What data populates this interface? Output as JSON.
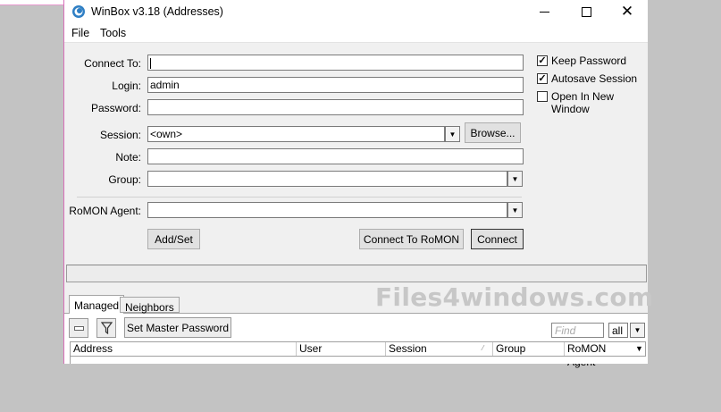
{
  "window": {
    "title": "WinBox v3.18 (Addresses)",
    "minimize_icon": "minimize-icon",
    "maximize_icon": "maximize-icon",
    "close_icon": "close-icon"
  },
  "menu": {
    "file": "File",
    "tools": "Tools"
  },
  "form": {
    "connect_to_label": "Connect To:",
    "connect_to_value": "",
    "login_label": "Login:",
    "login_value": "admin",
    "password_label": "Password:",
    "password_value": "",
    "session_label": "Session:",
    "session_value": "<own>",
    "browse_label": "Browse...",
    "note_label": "Note:",
    "note_value": "",
    "group_label": "Group:",
    "group_value": "",
    "romon_label": "RoMON Agent:",
    "romon_value": ""
  },
  "options": {
    "keep_password": {
      "label": "Keep Password",
      "checked": true
    },
    "autosave_session": {
      "label": "Autosave Session",
      "checked": true
    },
    "open_new_window": {
      "label": "Open In New Window",
      "checked": false
    }
  },
  "buttons": {
    "add_set": "Add/Set",
    "connect_romon": "Connect To RoMON",
    "connect": "Connect"
  },
  "watermark": "Files4windows.com",
  "tabs": {
    "managed": "Managed",
    "neighbors": "Neighbors"
  },
  "toolbar": {
    "set_master_password": "Set Master Password",
    "find_placeholder": "Find",
    "filter_value": "all"
  },
  "table": {
    "columns": [
      "Address",
      "User",
      "Session",
      "Group",
      "RoMON Agent"
    ]
  }
}
